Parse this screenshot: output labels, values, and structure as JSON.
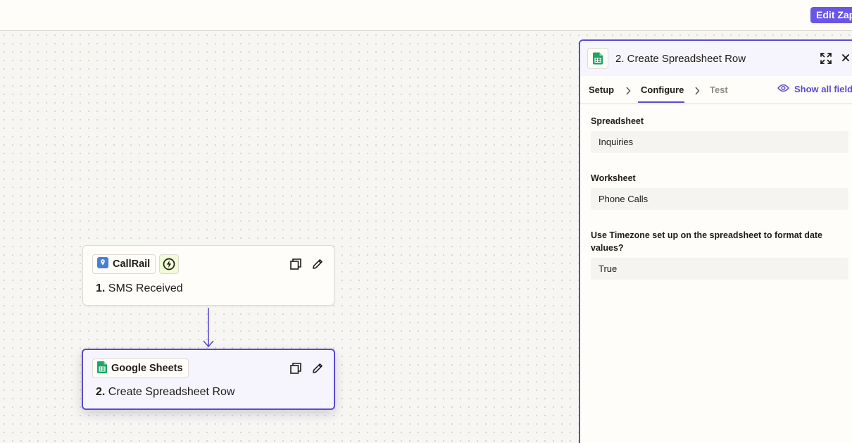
{
  "topbar": {
    "edit_button": "Edit Zap"
  },
  "steps": [
    {
      "app": "CallRail",
      "number": "1.",
      "title": "SMS Received",
      "trigger_icon": "lightning-bolt-icon"
    },
    {
      "app": "Google Sheets",
      "number": "2.",
      "title": "Create Spreadsheet Row"
    }
  ],
  "panel": {
    "title": "2. Create Spreadsheet Row",
    "tabs": [
      "Setup",
      "Configure",
      "Test"
    ],
    "active_tab": "Configure",
    "show_all_fields": "Show all fields",
    "fields": [
      {
        "label": "Spreadsheet",
        "value": "Inquiries"
      },
      {
        "label": "Worksheet",
        "value": "Phone Calls"
      },
      {
        "label": "Use Timezone set up on the spreadsheet to format date values?",
        "value": "True"
      }
    ]
  },
  "colors": {
    "accent": "#5b4bcf",
    "edit_button": "#6955e6",
    "sheets_green": "#1fa463",
    "callrail_blue": "#4a7fd6"
  }
}
